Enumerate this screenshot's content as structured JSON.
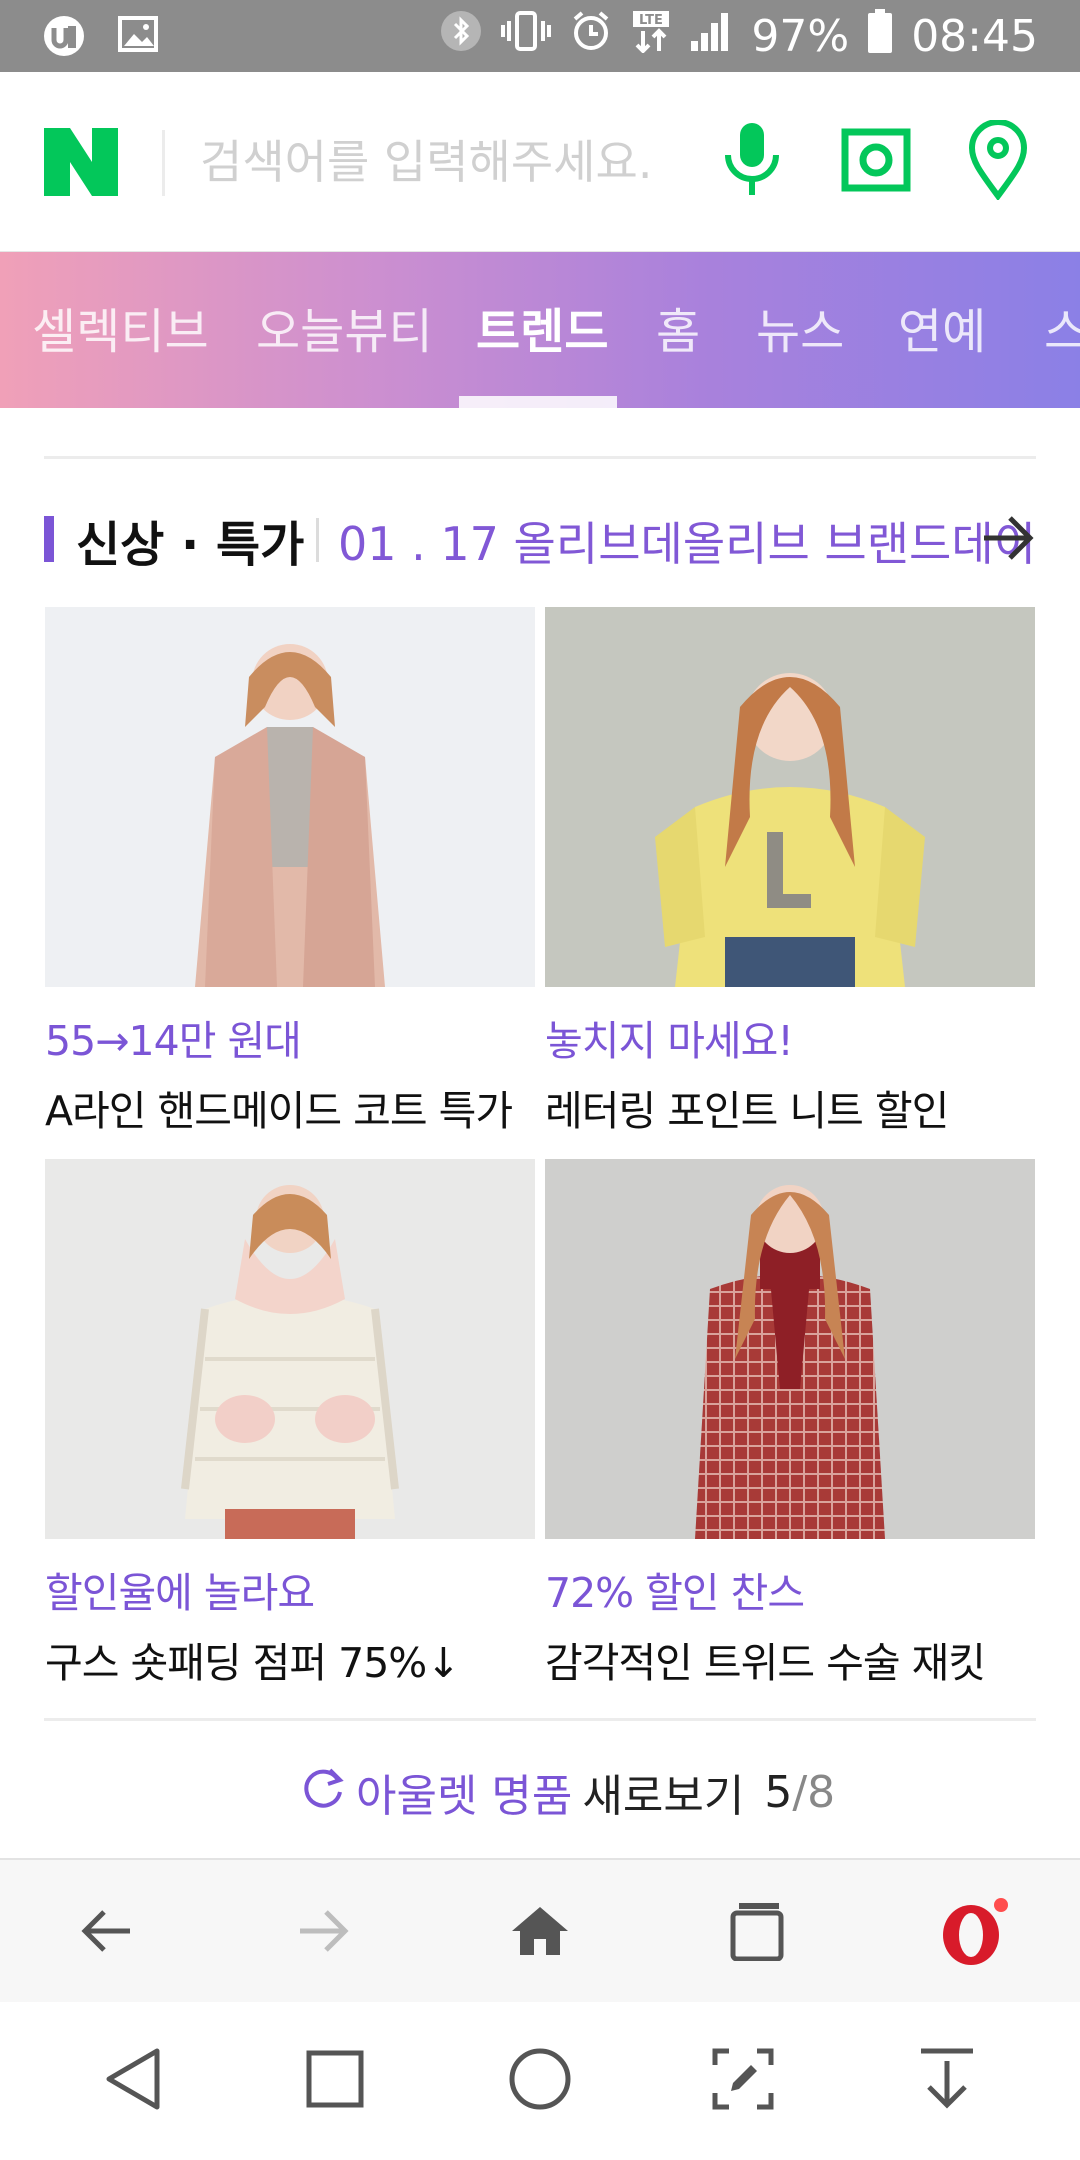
{
  "status_bar": {
    "battery": "97%",
    "time": "08:45",
    "network": "LTE",
    "icons": [
      "app-notification-icon",
      "image-notification-icon",
      "bluetooth-icon",
      "vibrate-icon",
      "alarm-icon",
      "lte-icon",
      "signal-icon",
      "battery-icon"
    ]
  },
  "search": {
    "placeholder": "검색어를 입력해주세요.",
    "logo_letter": "N",
    "brand_color": "#03c75a"
  },
  "tabs": [
    {
      "label": "셀렉티브",
      "active": false
    },
    {
      "label": "오늘뷰티",
      "active": false
    },
    {
      "label": "트렌드",
      "active": true
    },
    {
      "label": "홈",
      "active": false
    },
    {
      "label": "뉴스",
      "active": false
    },
    {
      "label": "연예",
      "active": false
    },
    {
      "label": "스",
      "active": false
    }
  ],
  "section": {
    "title": "신상 · 특가",
    "link": "01 . 17 올리브데올리브 브랜드데이",
    "accent_color": "#7b55d6"
  },
  "products": [
    {
      "promo": "55→14만 원대",
      "desc": "A라인 핸드메이드 코트 특가"
    },
    {
      "promo": "놓치지 마세요!",
      "desc": "레터링 포인트 니트 할인"
    },
    {
      "promo": "할인율에 놀라요",
      "desc": "구스 숏패딩 점퍼 75%↓"
    },
    {
      "promo": "72% 할인 찬스",
      "desc": "감각적인 트위드 수술 재킷"
    }
  ],
  "refresh": {
    "label_highlight": "아울렛 명품",
    "label": "새로보기",
    "page": "5",
    "total": "/8"
  },
  "browser_bar": {
    "buttons": [
      "back-icon",
      "forward-icon",
      "home-icon",
      "tabs-icon",
      "opera-menu-icon"
    ]
  },
  "android_nav": {
    "buttons": [
      "nav-back-icon",
      "nav-recents-icon",
      "nav-home-icon",
      "screenshot-edit-icon",
      "download-icon"
    ]
  }
}
